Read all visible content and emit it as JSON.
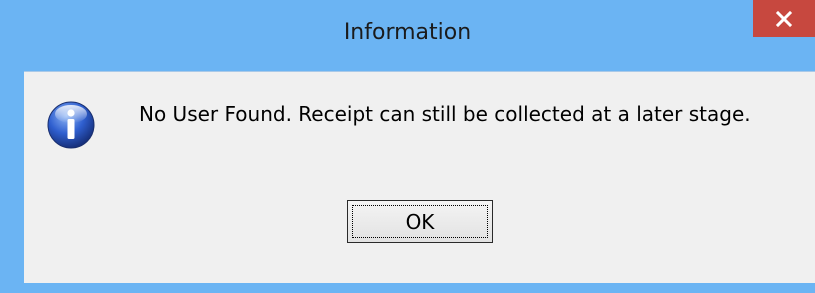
{
  "dialog": {
    "title": "Information",
    "message": "No User Found. Receipt can still be collected at a later stage.",
    "ok_label": "OK",
    "icon": "information-icon",
    "close_icon": "close-icon"
  },
  "colors": {
    "frame": "#6bb4f3",
    "close_button": "#c7483f",
    "client_background": "#f0f0f0"
  }
}
